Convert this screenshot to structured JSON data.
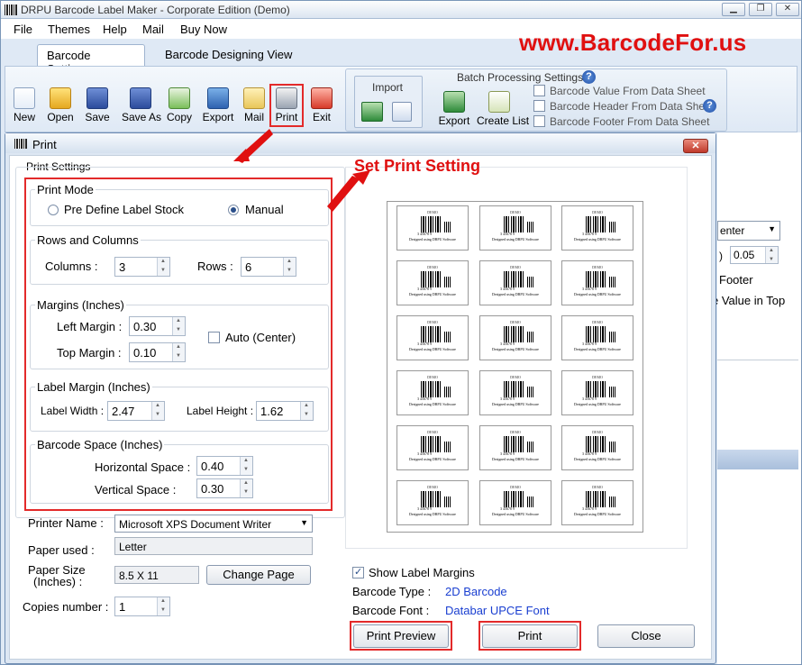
{
  "app": {
    "title": "DRPU Barcode Label Maker - Corporate Edition (Demo)",
    "website": "www.BarcodeFor.us"
  },
  "menu": [
    {
      "label": "File"
    },
    {
      "label": "Themes"
    },
    {
      "label": "Help"
    },
    {
      "label": "Mail"
    },
    {
      "label": "Buy Now"
    }
  ],
  "tabs": [
    "Barcode Settings",
    "Barcode Designing View"
  ],
  "toolbar": [
    "New",
    "Open",
    "Save",
    "Save As",
    "Copy",
    "Export",
    "Mail",
    "Print",
    "Exit"
  ],
  "import_group": {
    "title": "Import"
  },
  "batch": {
    "title": "Batch Processing Settings",
    "export": "Export",
    "create_list": "Create List",
    "options": [
      "Barcode Value From Data Sheet",
      "Barcode Header From Data Sheet",
      "Barcode Footer From Data Sheet"
    ]
  },
  "background": {
    "align": "enter",
    "spin_value": "0.05",
    "footer": "Footer",
    "value_top": "e Value in Top",
    "paren": ")"
  },
  "dialog": {
    "title": "Print",
    "annotation": "Set Print Setting",
    "print_settings": "Print Settings",
    "print_mode": {
      "title": "Print Mode",
      "options": [
        "Pre Define Label Stock",
        "Manual"
      ],
      "selected": "Manual"
    },
    "rows_columns": {
      "title": "Rows and Columns",
      "columns_label": "Columns :",
      "columns": "3",
      "rows_label": "Rows :",
      "rows": "6"
    },
    "margins": {
      "title": "Margins (Inches)",
      "left_label": "Left Margin :",
      "left": "0.30",
      "top_label": "Top Margin :",
      "top": "0.10",
      "auto_label": "Auto (Center)"
    },
    "label_margin": {
      "title": "Label Margin (Inches)",
      "width_label": "Label Width :",
      "width": "2.47",
      "height_label": "Label Height :",
      "height": "1.62"
    },
    "barcode_space": {
      "title": "Barcode Space (Inches)",
      "h_label": "Horizontal Space :",
      "h": "0.40",
      "v_label": "Vertical Space :",
      "v": "0.30"
    },
    "printer": {
      "name_label": "Printer Name :",
      "name": "Microsoft XPS Document Writer",
      "paper_label": "Paper used :",
      "paper": "Letter",
      "size_label": "Paper Size",
      "size_label2": "(Inches) :",
      "size": "8.5 X 11",
      "change_page": "Change Page",
      "copies_label": "Copies number :",
      "copies": "1"
    },
    "preview": {
      "label_demo": "DEMO",
      "label_number": "3 45678 9",
      "label_footer": "Designed using DRPU Software",
      "rows": 6,
      "cols": 3
    },
    "show_margins": "Show Label Margins",
    "barcode_type_label": "Barcode Type :",
    "barcode_type": "2D Barcode",
    "barcode_font_label": "Barcode Font :",
    "barcode_font": "Databar UPCE Font",
    "buttons": {
      "preview": "Print Preview",
      "print": "Print",
      "close": "Close"
    }
  }
}
